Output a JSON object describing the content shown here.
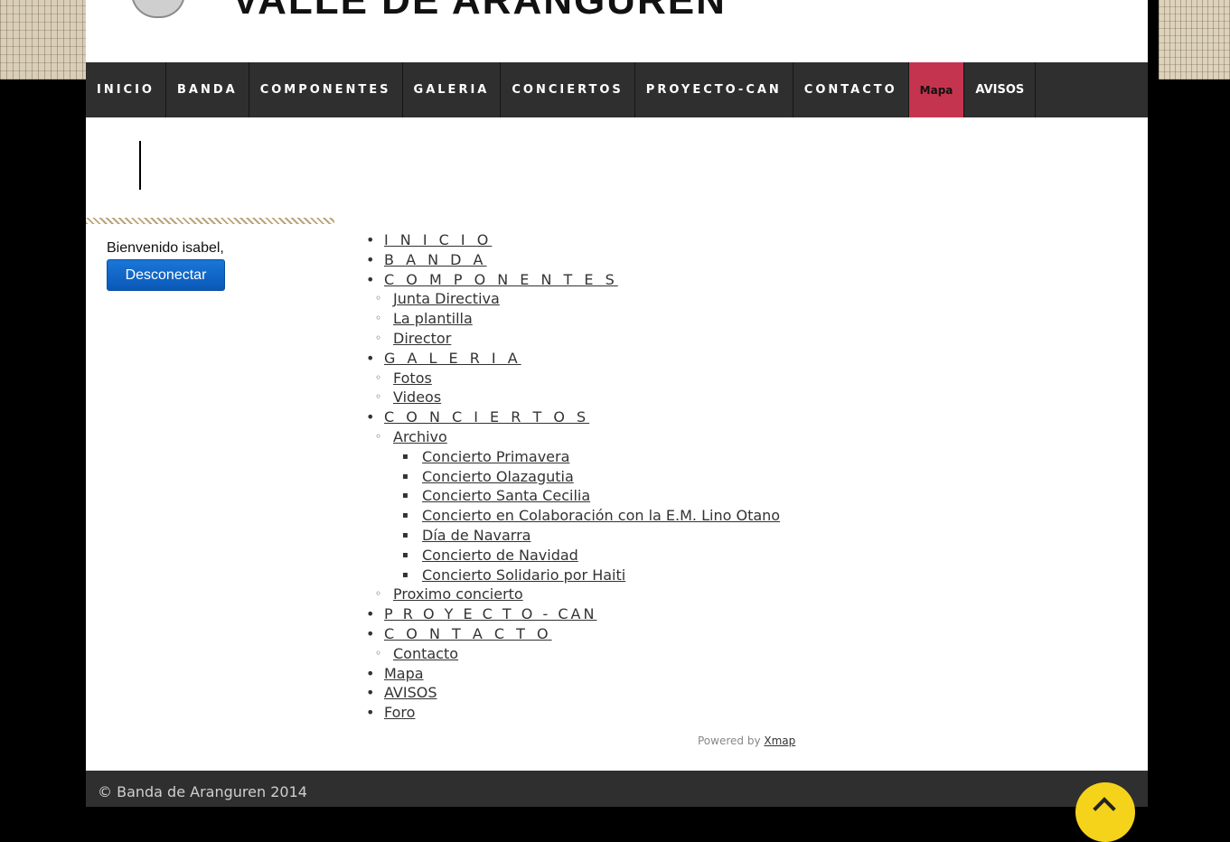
{
  "header": {
    "site_title": "VALLE DE ARANGUREN"
  },
  "topnav": {
    "items": [
      "INICIO",
      "BANDA",
      "COMPONENTES",
      "GALERIA",
      "CONCIERTOS",
      "PROYECTO-CAN",
      "CONTACTO",
      "Mapa",
      "AVISOS"
    ],
    "active_color": "#c5344f"
  },
  "login": {
    "welcome": "Bienvenido isabel,",
    "logout_label": "Desconectar"
  },
  "sitemap": {
    "inicio": "I N I C I O",
    "banda": "B A N D A",
    "componentes": "C O M P O N E N T E S",
    "componentes_children": [
      "Junta Directiva",
      "La plantilla",
      "Director"
    ],
    "galeria": "G A L E R I A",
    "galeria_children": [
      "Fotos",
      "Videos"
    ],
    "conciertos": "C O N C I E R T O S",
    "archivo": "Archivo",
    "archivo_children": [
      "Concierto Primavera",
      "Concierto Olazagutia",
      "Concierto Santa Cecilia",
      "Concierto en Colaboración con la E.M. Lino Otano",
      "Día de Navarra",
      "Concierto de Navidad",
      "Concierto Solidario por Haiti"
    ],
    "proximo": "Proximo concierto",
    "proyecto": "P R O Y E C T O - CAN",
    "contacto": "C O N T A C T O",
    "contacto_children": [
      "Contacto"
    ],
    "mapa": "Mapa",
    "avisos": "AVISOS",
    "foro": "Foro"
  },
  "powered": {
    "prefix": "Powered by ",
    "link": "Xmap"
  },
  "footer": {
    "copyright": "© Banda de Aranguren 2014"
  },
  "icons": {
    "bullet_l1": "•",
    "bullet_l2": "◦",
    "bullet_l3": "▪"
  }
}
